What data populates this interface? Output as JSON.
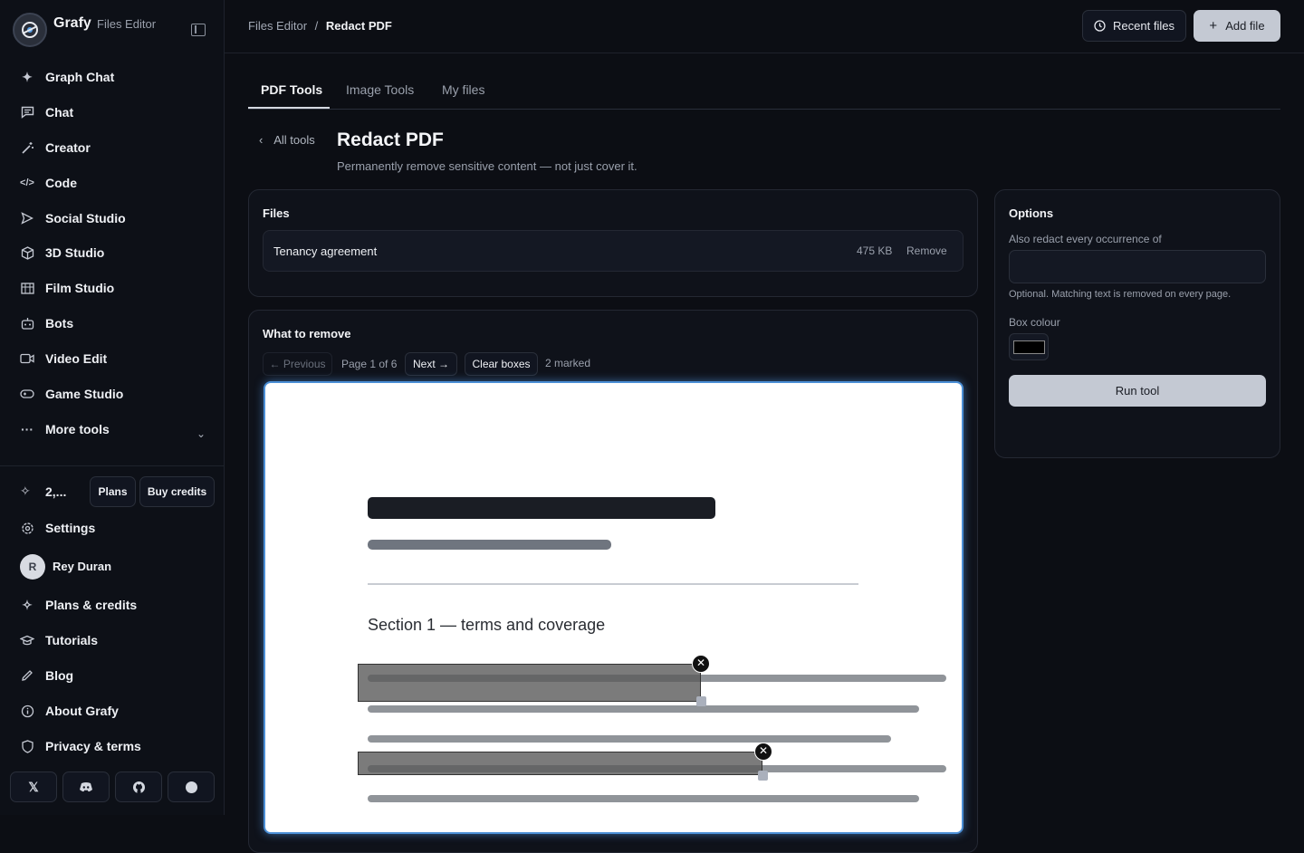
{
  "brand": {
    "name": "Grafy",
    "sub": "Files Editor"
  },
  "nav": [
    {
      "label": "Graph Chat",
      "icon": "sparkle-icon"
    },
    {
      "label": "Chat",
      "icon": "chat-icon"
    },
    {
      "label": "Creator",
      "icon": "wand-icon"
    },
    {
      "label": "Code",
      "icon": "code-icon"
    },
    {
      "label": "Social Studio",
      "icon": "send-icon"
    },
    {
      "label": "3D Studio",
      "icon": "cube-icon"
    },
    {
      "label": "Film Studio",
      "icon": "film-icon"
    },
    {
      "label": "Bots",
      "icon": "bot-icon"
    },
    {
      "label": "Video Edit",
      "icon": "video-icon"
    },
    {
      "label": "Game Studio",
      "icon": "gamepad-icon"
    },
    {
      "label": "More tools",
      "icon": "dots-icon"
    }
  ],
  "credits": {
    "amount": "2,...",
    "plans_label": "Plans",
    "buy_label": "Buy credits"
  },
  "footer_nav": [
    {
      "label": "Settings",
      "icon": "gear-icon"
    },
    {
      "label": "Plans & credits",
      "icon": "sparkle-icon"
    },
    {
      "label": "Tutorials",
      "icon": "graduation-icon"
    },
    {
      "label": "Blog",
      "icon": "pen-icon"
    },
    {
      "label": "About Grafy",
      "icon": "info-icon"
    },
    {
      "label": "Privacy & terms",
      "icon": "shield-icon"
    }
  ],
  "user": {
    "initial": "R",
    "name": "Rey Duran"
  },
  "social": [
    "X",
    "discord-icon",
    "github-icon",
    "circle-icon"
  ],
  "breadcrumb": {
    "parent": "Files Editor",
    "sep": "/",
    "current": "Redact PDF"
  },
  "header": {
    "recent_label": "Recent files",
    "add_label": "Add file"
  },
  "tabs": [
    "PDF Tools",
    "Image Tools",
    "My files"
  ],
  "tool": {
    "back_label": "All tools",
    "title": "Redact PDF",
    "subtitle": "Permanently remove sensitive content — not just cover it."
  },
  "files": {
    "title": "Files",
    "items": [
      {
        "name": "Tenancy agreement",
        "size": "475 KB",
        "remove_label": "Remove"
      }
    ]
  },
  "remove": {
    "title": "What to remove",
    "prev_label": "← Previous",
    "page_label": "Page 1 of 6",
    "next_label": "Next →",
    "clear_label": "Clear boxes",
    "marked_label": "2 marked"
  },
  "doc": {
    "section_heading": "Section 1 — terms and coverage"
  },
  "options": {
    "title": "Options",
    "occurrence_label": "Also redact every occurrence of",
    "occurrence_value": "",
    "occurrence_hint": "Optional. Matching text is removed on every page.",
    "colour_label": "Box colour",
    "box_colour": "#000000",
    "run_label": "Run tool"
  },
  "colors": {
    "accent_glow": "#4b8fd6",
    "primary_button": "#c4c9d3"
  }
}
